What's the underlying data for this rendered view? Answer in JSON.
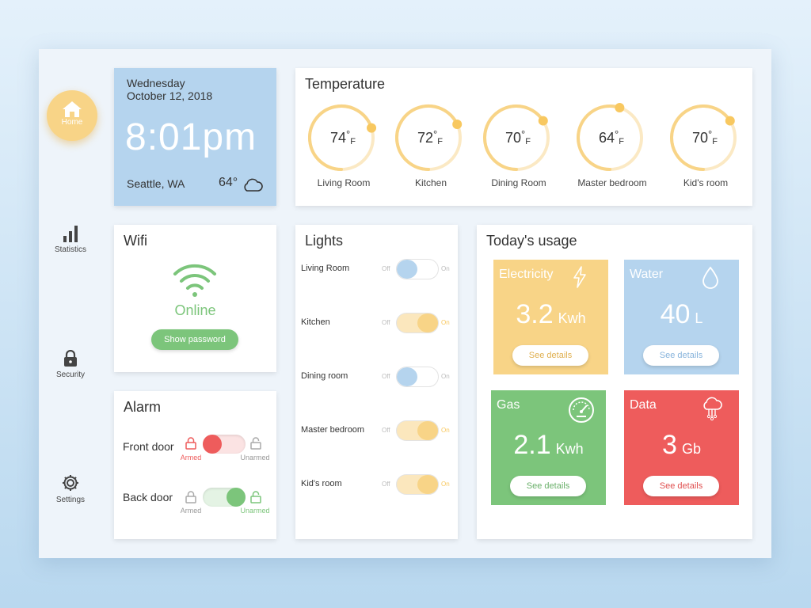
{
  "colors": {
    "accent_yellow": "#f8d487",
    "light_blue": "#b5d4ee",
    "green": "#7cc57b",
    "red": "#ee5c5c",
    "toggle_blue": "#b5d4ee"
  },
  "sidebar": {
    "items": [
      {
        "label": "Home",
        "icon": "home-icon",
        "active": true
      },
      {
        "label": "Statistics",
        "icon": "bar-chart-icon"
      },
      {
        "label": "Security",
        "icon": "lock-icon"
      },
      {
        "label": "Settings",
        "icon": "gear-icon"
      }
    ]
  },
  "datetime": {
    "day": "Wednesday",
    "date": "October 12, 2018",
    "time": "8:01pm",
    "location": "Seattle, WA",
    "outside_temp": "64°",
    "weather_icon": "cloud-icon"
  },
  "temperature": {
    "title": "Temperature",
    "unit": "F",
    "rooms": [
      {
        "name": "Living Room",
        "value": "74",
        "level": 0.7
      },
      {
        "name": "Kitchen",
        "value": "72",
        "level": 0.68
      },
      {
        "name": "Dining Room",
        "value": "70",
        "level": 0.66
      },
      {
        "name": "Master bedroom",
        "value": "64",
        "level": 0.55
      },
      {
        "name": "Kid's room",
        "value": "70",
        "level": 0.66
      }
    ]
  },
  "wifi": {
    "title": "Wifi",
    "status": "Online",
    "button": "Show password"
  },
  "alarm": {
    "title": "Alarm",
    "armed_label": "Armed",
    "unarmed_label": "Unarmed",
    "doors": [
      {
        "name": "Front door",
        "state": "Armed"
      },
      {
        "name": "Back door",
        "state": "Unarmed"
      }
    ]
  },
  "lights": {
    "title": "Lights",
    "off_label": "Off",
    "on_label": "On",
    "rooms": [
      {
        "name": "Living Room",
        "on": false
      },
      {
        "name": "Kitchen",
        "on": true
      },
      {
        "name": "Dining room",
        "on": false
      },
      {
        "name": "Master bedroom",
        "on": true
      },
      {
        "name": "Kid's room",
        "on": true
      }
    ]
  },
  "usage": {
    "title": "Today's usage",
    "details_label": "See details",
    "tiles": [
      {
        "name": "Electricity",
        "value": "3.2",
        "unit": "Kwh",
        "color": "#f8d487",
        "icon": "lightning-icon"
      },
      {
        "name": "Water",
        "value": "40",
        "unit": "L",
        "color": "#b5d4ee",
        "icon": "water-drop-icon"
      },
      {
        "name": "Gas",
        "value": "2.1",
        "unit": "Kwh",
        "color": "#7cc57b",
        "icon": "gauge-icon"
      },
      {
        "name": "Data",
        "value": "3",
        "unit": "Gb",
        "color": "#ee5c5c",
        "icon": "cloud-network-icon"
      }
    ]
  }
}
